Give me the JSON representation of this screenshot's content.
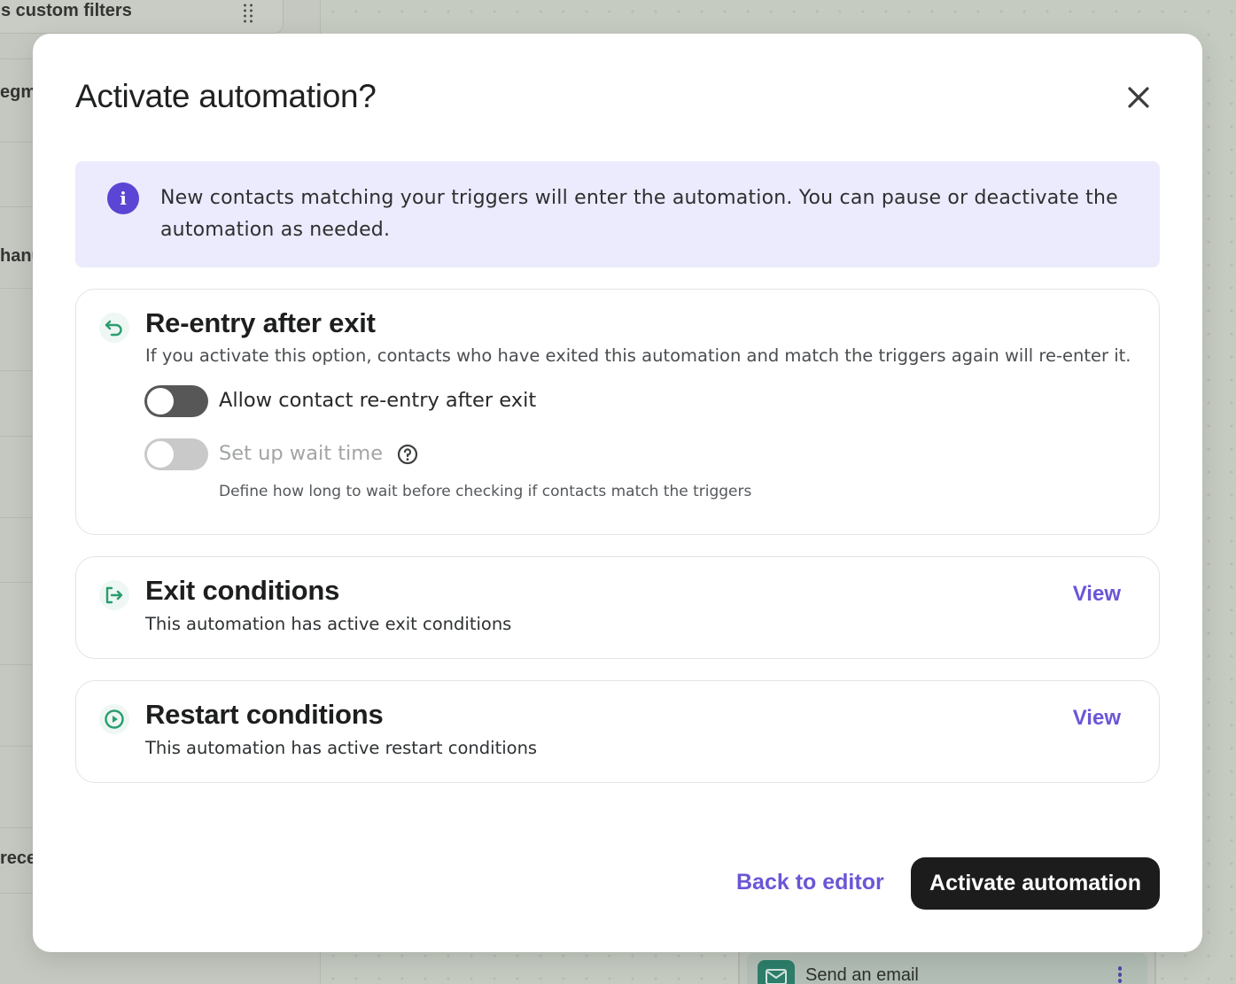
{
  "background": {
    "sidebar_fragments": [
      "s custom filters",
      "egm",
      "hanu",
      "rece"
    ],
    "email_node_label": "Send an email"
  },
  "modal": {
    "title": "Activate automation?",
    "info_text": "New contacts matching your triggers will enter the automation. You can pause or deactivate the automation as needed.",
    "reentry": {
      "title": "Re-entry after exit",
      "description": "If you activate this option, contacts who have exited this automation and match the triggers again will re-enter it.",
      "allow_label": "Allow contact re-entry after exit",
      "allow_enabled": false,
      "wait_label": "Set up wait time",
      "wait_enabled": false,
      "wait_hint": "Define how long to wait before checking if contacts match the triggers"
    },
    "exit": {
      "title": "Exit conditions",
      "description": "This automation has active exit conditions",
      "link": "View"
    },
    "restart": {
      "title": "Restart conditions",
      "description": "This automation has active restart conditions",
      "link": "View"
    },
    "back_label": "Back to editor",
    "primary_label": "Activate automation"
  },
  "colors": {
    "accent": "#6a56d6",
    "info_icon": "#5a45d4",
    "info_bg": "#ebebfd",
    "section_icon": "#2a9d6f",
    "primary_button": "#1c1c1c"
  }
}
